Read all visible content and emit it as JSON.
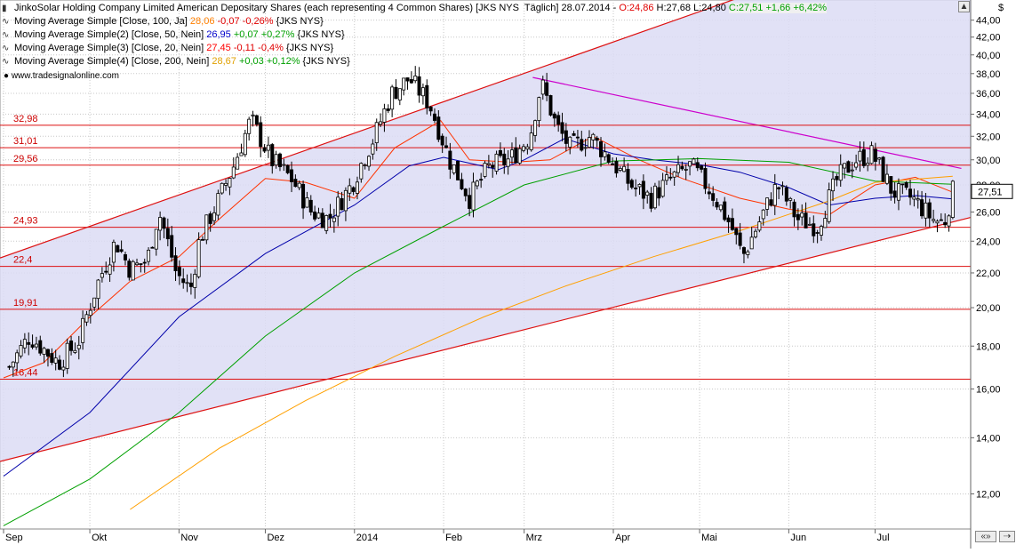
{
  "header": {
    "title": "JinkoSolar Holding Company Limited American Depositary Shares (each representing 4 Common Shares) [JKS NYS  Täglich] 28.07.2014 - ",
    "open": "O:24,86",
    "high": "H:27,68",
    "low": "L:24,80",
    "close": "C:27,51",
    "change": "+1,66",
    "change_pct": "+6,42%"
  },
  "indicators": [
    {
      "label": "Moving Average Simple [Close, 100, Ja]",
      "value": "28,06",
      "change": "-0,07",
      "change_pct": "-0,26%",
      "suffix": "{JKS NYS}",
      "color": "#ff7f00"
    },
    {
      "label": "Moving Average Simple(2) [Close, 50, Nein]",
      "value": "26,95",
      "change": "+0,07",
      "change_pct": "+0,27%",
      "suffix": "{JKS NYS}",
      "color": "#0000cc"
    },
    {
      "label": "Moving Average Simple(3) [Close, 20, Nein]",
      "value": "27,45",
      "change": "-0,11",
      "change_pct": "-0,4%",
      "suffix": "{JKS NYS}",
      "color": "#ff0000"
    },
    {
      "label": "Moving Average Simple(4) [Close, 200, Nein]",
      "value": "28,67",
      "change": "+0,03",
      "change_pct": "+0,12%",
      "suffix": "{JKS NYS}",
      "color": "#e0a000"
    }
  ],
  "copyright": "www.tradesignalonline.com",
  "axis_unit_symbol": "$",
  "last_price_tag": "27,51",
  "colors": {
    "channel_fill": "#dcdcf4",
    "channel_line": "#dd1111",
    "resistance_line": "#cc00cc",
    "hline": "#dd1111",
    "grid": "#c8c8c8",
    "candle_up": "#ffffff",
    "candle_down": "#000000",
    "sma20": "#ff3300",
    "sma50": "#0000aa",
    "sma100": "#00a000",
    "sma200": "#ffa000"
  },
  "chart_data": {
    "type": "candlestick",
    "y_scale": "log",
    "ylim": [
      10.9,
      46.5
    ],
    "y_ticks": [
      "44,00",
      "42,00",
      "40,00",
      "38,00",
      "36,00",
      "34,00",
      "32,00",
      "30,00",
      "28,00",
      "26,00",
      "24,00",
      "22,00",
      "20,00",
      "18,00",
      "16,00",
      "14,00",
      "12,00"
    ],
    "x_ticks": [
      {
        "label": "Sep",
        "date": "2013-09-01"
      },
      {
        "label": "Okt",
        "date": "2013-10-01"
      },
      {
        "label": "Nov",
        "date": "2013-11-01"
      },
      {
        "label": "Dez",
        "date": "2013-12-01"
      },
      {
        "label": "2014",
        "date": "2014-01-01"
      },
      {
        "label": "Feb",
        "date": "2014-02-01"
      },
      {
        "label": "Mrz",
        "date": "2014-03-01"
      },
      {
        "label": "Apr",
        "date": "2014-04-01"
      },
      {
        "label": "Mai",
        "date": "2014-05-01"
      },
      {
        "label": "Jun",
        "date": "2014-06-01"
      },
      {
        "label": "Jul",
        "date": "2014-07-01"
      }
    ],
    "horizontal_levels": [
      {
        "label": "32,98",
        "value": 32.98
      },
      {
        "label": "31,01",
        "value": 31.01
      },
      {
        "label": "29,56",
        "value": 29.56
      },
      {
        "label": "24,93",
        "value": 24.93
      },
      {
        "label": "22,4",
        "value": 22.4
      },
      {
        "label": "19,91",
        "value": 19.91
      },
      {
        "label": "16,44",
        "value": 16.44
      }
    ],
    "trend_lines": [
      {
        "name": "channel-upper",
        "from": {
          "date": "2013-09-01",
          "value": 23.0
        },
        "to": {
          "date": "2014-07-31",
          "value": 58.0
        }
      },
      {
        "name": "channel-lower",
        "from": {
          "date": "2013-09-01",
          "value": 13.15
        },
        "to": {
          "date": "2014-07-31",
          "value": 25.45
        }
      },
      {
        "name": "resistance",
        "from": {
          "date": "2014-03-04",
          "value": 37.6
        },
        "to": {
          "date": "2014-07-31",
          "value": 29.3
        }
      }
    ],
    "ma_anchors": {
      "sma20": [
        [
          "2013-09-01",
          16.5
        ],
        [
          "2013-09-15",
          17.2
        ],
        [
          "2013-10-01",
          19.5
        ],
        [
          "2013-10-15",
          21.5
        ],
        [
          "2013-11-01",
          23.0
        ],
        [
          "2013-11-15",
          25.5
        ],
        [
          "2013-12-01",
          28.5
        ],
        [
          "2013-12-15",
          28.2
        ],
        [
          "2014-01-01",
          27.0
        ],
        [
          "2014-01-15",
          31.0
        ],
        [
          "2014-01-31",
          33.4
        ],
        [
          "2014-02-10",
          30.0
        ],
        [
          "2014-02-25",
          29.8
        ],
        [
          "2014-03-10",
          30.0
        ],
        [
          "2014-03-25",
          32.0
        ],
        [
          "2014-04-10",
          30.0
        ],
        [
          "2014-04-25",
          28.5
        ],
        [
          "2014-05-15",
          27.0
        ],
        [
          "2014-06-01",
          26.2
        ],
        [
          "2014-06-15",
          25.8
        ],
        [
          "2014-07-01",
          28.0
        ],
        [
          "2014-07-15",
          28.6
        ],
        [
          "2014-07-28",
          27.45
        ]
      ],
      "sma50": [
        [
          "2013-09-01",
          12.6
        ],
        [
          "2013-10-01",
          15.0
        ],
        [
          "2013-11-01",
          19.5
        ],
        [
          "2013-12-01",
          23.2
        ],
        [
          "2014-01-01",
          26.5
        ],
        [
          "2014-01-20",
          29.5
        ],
        [
          "2014-02-01",
          30.2
        ],
        [
          "2014-02-20",
          29.2
        ],
        [
          "2014-03-01",
          30.0
        ],
        [
          "2014-03-15",
          31.8
        ],
        [
          "2014-04-01",
          30.5
        ],
        [
          "2014-04-15",
          30.0
        ],
        [
          "2014-05-01",
          29.6
        ],
        [
          "2014-05-15",
          29.0
        ],
        [
          "2014-06-01",
          27.8
        ],
        [
          "2014-06-15",
          26.5
        ],
        [
          "2014-07-01",
          27.0
        ],
        [
          "2014-07-15",
          27.2
        ],
        [
          "2014-07-28",
          26.95
        ]
      ],
      "sma100": [
        [
          "2013-09-01",
          11.0
        ],
        [
          "2013-10-01",
          12.5
        ],
        [
          "2013-11-01",
          15.0
        ],
        [
          "2013-12-01",
          18.5
        ],
        [
          "2014-01-01",
          22.0
        ],
        [
          "2014-02-01",
          25.0
        ],
        [
          "2014-03-01",
          28.0
        ],
        [
          "2014-04-01",
          29.9
        ],
        [
          "2014-05-01",
          30.1
        ],
        [
          "2014-06-01",
          29.8
        ],
        [
          "2014-07-01",
          28.3
        ],
        [
          "2014-07-28",
          28.06
        ]
      ],
      "sma200": [
        [
          "2013-09-15",
          9.5
        ],
        [
          "2013-10-15",
          11.5
        ],
        [
          "2013-11-15",
          13.6
        ],
        [
          "2013-12-15",
          15.5
        ],
        [
          "2014-01-15",
          17.5
        ],
        [
          "2014-02-15",
          19.5
        ],
        [
          "2014-03-15",
          21.2
        ],
        [
          "2014-04-15",
          23.0
        ],
        [
          "2014-05-15",
          24.7
        ],
        [
          "2014-06-15",
          26.8
        ],
        [
          "2014-07-01",
          28.2
        ],
        [
          "2014-07-28",
          28.67
        ]
      ]
    },
    "price_path": [
      [
        "2013-09-03",
        17.0
      ],
      [
        "2013-09-10",
        18.5
      ],
      [
        "2013-09-20",
        17.2
      ],
      [
        "2013-09-27",
        18.2
      ],
      [
        "2013-10-04",
        21.5
      ],
      [
        "2013-10-10",
        24.0
      ],
      [
        "2013-10-15",
        22.2
      ],
      [
        "2013-10-21",
        22.8
      ],
      [
        "2013-10-25",
        26.0
      ],
      [
        "2013-10-31",
        22.0
      ],
      [
        "2013-11-05",
        21.0
      ],
      [
        "2013-11-08",
        24.0
      ],
      [
        "2013-11-15",
        27.0
      ],
      [
        "2013-11-20",
        29.5
      ],
      [
        "2013-11-26",
        33.5
      ],
      [
        "2013-12-03",
        30.0
      ],
      [
        "2013-12-10",
        28.5
      ],
      [
        "2013-12-17",
        26.0
      ],
      [
        "2013-12-23",
        25.5
      ],
      [
        "2013-12-31",
        28.0
      ],
      [
        "2014-01-08",
        32.0
      ],
      [
        "2014-01-14",
        36.0
      ],
      [
        "2014-01-20",
        37.5
      ],
      [
        "2014-01-27",
        35.0
      ],
      [
        "2014-02-03",
        30.0
      ],
      [
        "2014-02-10",
        27.0
      ],
      [
        "2014-02-17",
        29.5
      ],
      [
        "2014-02-24",
        30.0
      ],
      [
        "2014-03-03",
        32.0
      ],
      [
        "2014-03-07",
        37.0
      ],
      [
        "2014-03-12",
        33.0
      ],
      [
        "2014-03-17",
        31.0
      ],
      [
        "2014-03-24",
        32.0
      ],
      [
        "2014-03-31",
        30.0
      ],
      [
        "2014-04-07",
        28.0
      ],
      [
        "2014-04-14",
        27.0
      ],
      [
        "2014-04-21",
        28.5
      ],
      [
        "2014-04-28",
        29.5
      ],
      [
        "2014-05-05",
        27.5
      ],
      [
        "2014-05-12",
        25.0
      ],
      [
        "2014-05-16",
        23.0
      ],
      [
        "2014-05-21",
        25.0
      ],
      [
        "2014-05-28",
        28.0
      ],
      [
        "2014-06-04",
        25.5
      ],
      [
        "2014-06-11",
        25.0
      ],
      [
        "2014-06-18",
        28.5
      ],
      [
        "2014-06-24",
        30.0
      ],
      [
        "2014-06-30",
        30.5
      ],
      [
        "2014-07-07",
        27.5
      ],
      [
        "2014-07-14",
        27.0
      ],
      [
        "2014-07-21",
        25.5
      ],
      [
        "2014-07-25",
        25.2
      ],
      [
        "2014-07-28",
        27.51
      ]
    ]
  }
}
